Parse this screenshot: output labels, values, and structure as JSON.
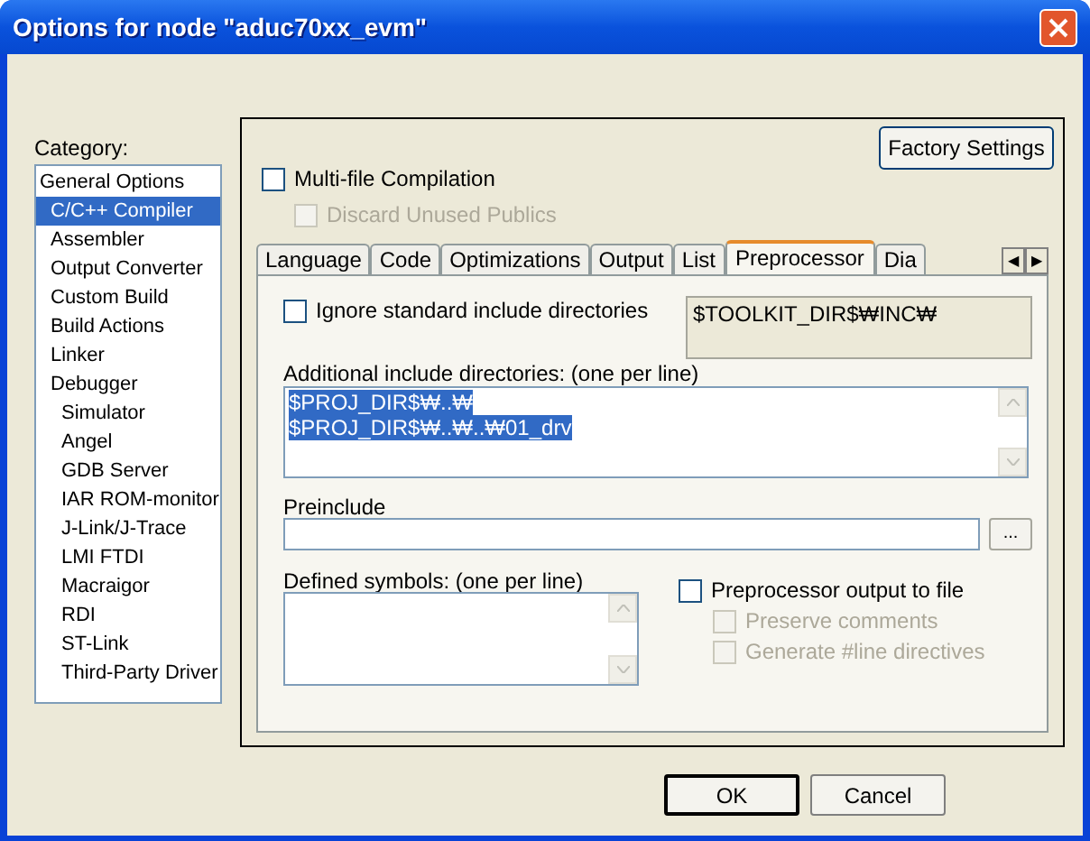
{
  "window": {
    "title": "Options for node \"aduc70xx_evm\""
  },
  "category": {
    "label": "Category:",
    "items": [
      {
        "label": "General Options",
        "selected": false,
        "children": [
          {
            "label": "C/C++ Compiler",
            "selected": true
          },
          {
            "label": "Assembler",
            "selected": false
          },
          {
            "label": "Output Converter",
            "selected": false
          },
          {
            "label": "Custom Build",
            "selected": false
          },
          {
            "label": "Build Actions",
            "selected": false
          },
          {
            "label": "Linker",
            "selected": false
          },
          {
            "label": "Debugger",
            "selected": false,
            "children": [
              {
                "label": "Simulator",
                "selected": false
              },
              {
                "label": "Angel",
                "selected": false
              },
              {
                "label": "GDB Server",
                "selected": false
              },
              {
                "label": "IAR ROM-monitor",
                "selected": false
              },
              {
                "label": "J-Link/J-Trace",
                "selected": false
              },
              {
                "label": "LMI FTDI",
                "selected": false
              },
              {
                "label": "Macraigor",
                "selected": false
              },
              {
                "label": "RDI",
                "selected": false
              },
              {
                "label": "ST-Link",
                "selected": false
              },
              {
                "label": "Third-Party Driver",
                "selected": false
              }
            ]
          }
        ]
      }
    ]
  },
  "factory_settings": "Factory Settings",
  "top_options": [
    {
      "label": "Multi-file Compilation",
      "checked": false,
      "disabled": false
    },
    {
      "label": "Discard Unused Publics",
      "checked": false,
      "disabled": true
    }
  ],
  "tabs": [
    {
      "label": "Language",
      "selected": false
    },
    {
      "label": "Code",
      "selected": false
    },
    {
      "label": "Optimizations",
      "selected": false
    },
    {
      "label": "Output",
      "selected": false
    },
    {
      "label": "List",
      "selected": false
    },
    {
      "label": "Preprocessor",
      "selected": true
    },
    {
      "label": "Dia",
      "selected": false
    }
  ],
  "tab_scroll": [
    "◀",
    "▶"
  ],
  "ignore_standard": {
    "label": "Ignore standard include directories",
    "checked": false,
    "disabled": false
  },
  "standard_include": "$TOOLKIT_DIR$₩INC₩",
  "additional_include": {
    "label": "Additional include directories: (one per line)",
    "lines": [
      {
        "text": "$PROJ_DIR$₩..₩",
        "selected": true
      },
      {
        "text": "$PROJ_DIR$₩..₩..₩01_drv",
        "selected": true
      }
    ]
  },
  "preinclude": {
    "label": "Preinclude",
    "browse": "..."
  },
  "defined_symbols": {
    "label": "Defined symbols: (one per line)"
  },
  "output_options": [
    {
      "label": "Preprocessor output to file",
      "checked": false,
      "disabled": false,
      "kind": "main"
    },
    {
      "label": "Preserve comments",
      "checked": false,
      "disabled": true,
      "kind": "sub"
    },
    {
      "label": "Generate #line directives",
      "checked": false,
      "disabled": true,
      "kind": "sub"
    }
  ],
  "buttons": [
    {
      "label": "OK",
      "default": true
    },
    {
      "label": "Cancel",
      "default": false
    }
  ]
}
